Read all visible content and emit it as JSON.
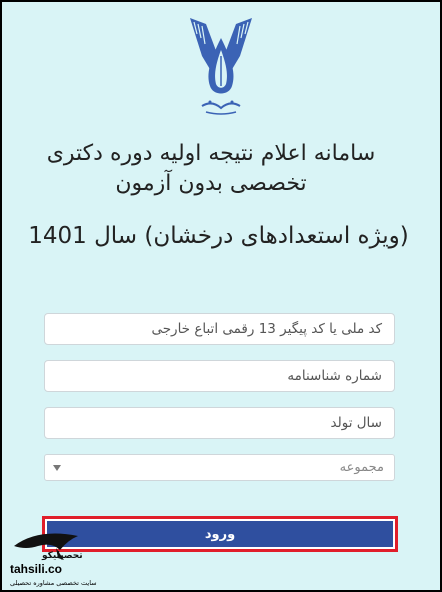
{
  "header": {
    "title": "سامانه اعلام نتیجه اولیه دوره دکتری تخصصی بدون آزمون",
    "subtitle": "(ویژه استعدادهای درخشان) سال 1401"
  },
  "form": {
    "national_code_placeholder": "کد ملی یا کد پیگیر 13 رقمی اتباع خارجی",
    "id_number_placeholder": "شماره شناسنامه",
    "birth_year_placeholder": "سال تولد",
    "group_select_value": "مجموعه",
    "submit_label": "ورود"
  },
  "watermark": {
    "brand_fa": "تحصیلیکو",
    "brand_en": "tahsili.co",
    "tagline": "سایت تخصصی مشاوره تحصیلی"
  }
}
